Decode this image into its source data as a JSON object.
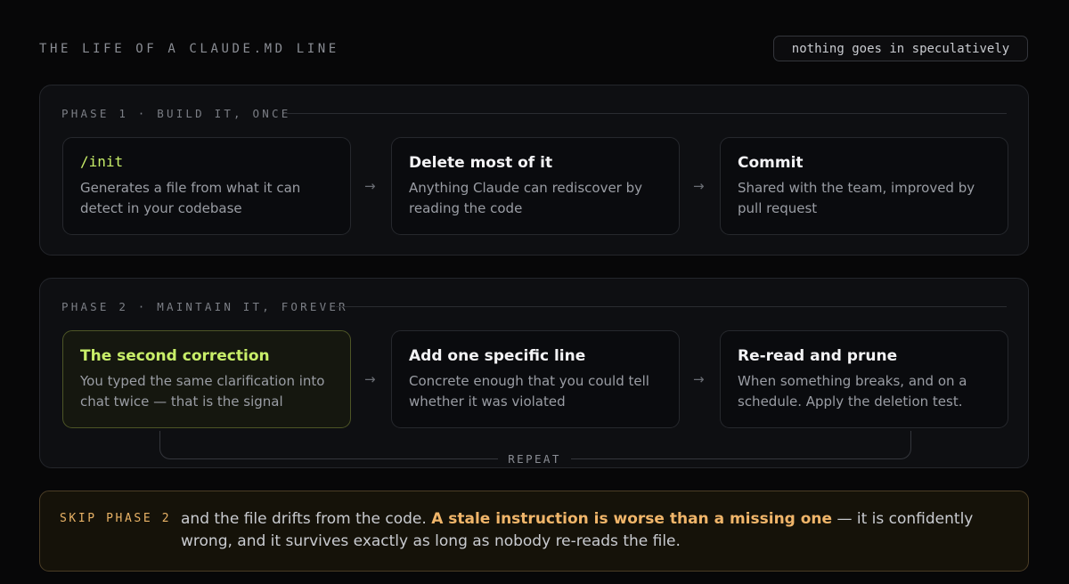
{
  "header": {
    "title": "THE LIFE OF A CLAUDE.MD LINE",
    "tag": "nothing goes in speculatively"
  },
  "phase1": {
    "label": "PHASE 1 · BUILD IT, ONCE",
    "steps": [
      {
        "title": "/init",
        "desc": "Generates a file from what it can detect in your codebase"
      },
      {
        "title": "Delete most of it",
        "desc": "Anything Claude can rediscover by reading the code"
      },
      {
        "title": "Commit",
        "desc": "Shared with the team, improved by pull request"
      }
    ]
  },
  "phase2": {
    "label": "PHASE 2 · MAINTAIN IT, FOREVER",
    "steps": [
      {
        "title": "The second correction",
        "desc": "You typed the same clarification into chat twice — that is the signal"
      },
      {
        "title": "Add one specific line",
        "desc": "Concrete enough that you could tell whether it was violated"
      },
      {
        "title": "Re-read and prune",
        "desc": "When something breaks, and on a schedule. Apply the deletion test."
      }
    ],
    "loop_label": "REPEAT"
  },
  "arrow_glyph": "→",
  "warning": {
    "label": "SKIP PHASE 2",
    "text_before": "and the file drifts from the code. ",
    "text_emphasis": "A stale instruction is worse than a missing one",
    "text_after": " — it is confidently wrong, and it survives exactly as long as nobody re-reads the file."
  },
  "colors": {
    "accent_green": "#c8ee69",
    "warning_amber": "#f0b56a",
    "background": "#070708"
  }
}
